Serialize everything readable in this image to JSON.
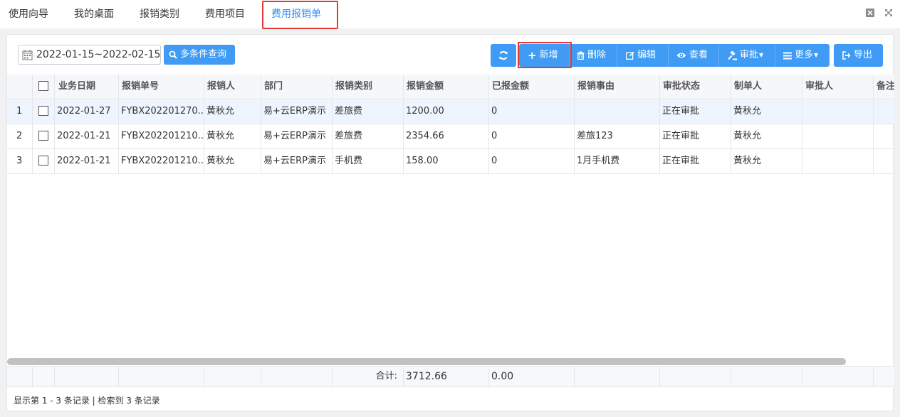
{
  "tabs": [
    {
      "label": "使用向导",
      "active": false
    },
    {
      "label": "我的桌面",
      "active": false
    },
    {
      "label": "报销类别",
      "active": false
    },
    {
      "label": "费用项目",
      "active": false
    },
    {
      "label": "费用报销单",
      "active": true
    }
  ],
  "window_icons": [
    "close-icon",
    "fullscreen-icon"
  ],
  "toolbar": {
    "date_range": "2022-01-15~2022-02-15",
    "query_label": "多条件查询",
    "buttons": {
      "refresh": "",
      "add": "新增",
      "delete": "删除",
      "edit": "编辑",
      "view": "查看",
      "approve": "审批",
      "more": "更多",
      "export": "导出"
    }
  },
  "columns": [
    "",
    "",
    "业务日期",
    "报销单号",
    "报销人",
    "部门",
    "报销类别",
    "报销金额",
    "已报金额",
    "报销事由",
    "审批状态",
    "制单人",
    "审批人",
    "备注"
  ],
  "rows": [
    {
      "index": "1",
      "date": "2022-01-27",
      "number": "FYBX202201270...",
      "person": "黄秋允",
      "dept": "易+云ERP演示",
      "category": "差旅费",
      "amount": "1200.00",
      "paid": "0",
      "reason": "",
      "status": "正在审批",
      "maker": "黄秋允",
      "approver": "",
      "remark": ""
    },
    {
      "index": "2",
      "date": "2022-01-21",
      "number": "FYBX202201210...",
      "person": "黄秋允",
      "dept": "易+云ERP演示",
      "category": "差旅费",
      "amount": "2354.66",
      "paid": "0",
      "reason": "差旅123",
      "status": "正在审批",
      "maker": "黄秋允",
      "approver": "",
      "remark": ""
    },
    {
      "index": "3",
      "date": "2022-01-21",
      "number": "FYBX202201210...",
      "person": "黄秋允",
      "dept": "易+云ERP演示",
      "category": "手机费",
      "amount": "158.00",
      "paid": "0",
      "reason": "1月手机费",
      "status": "正在审批",
      "maker": "黄秋允",
      "approver": "",
      "remark": ""
    }
  ],
  "footer": {
    "total_label": "合计:",
    "total_amount": "3712.66",
    "total_paid": "0.00"
  },
  "pager_text": "显示第 1 - 3 条记录 | 检索到 3 条记录",
  "colors": {
    "accent": "#3f9bf3",
    "active_tab": "#2d8cf0",
    "highlight": "#e53935"
  }
}
